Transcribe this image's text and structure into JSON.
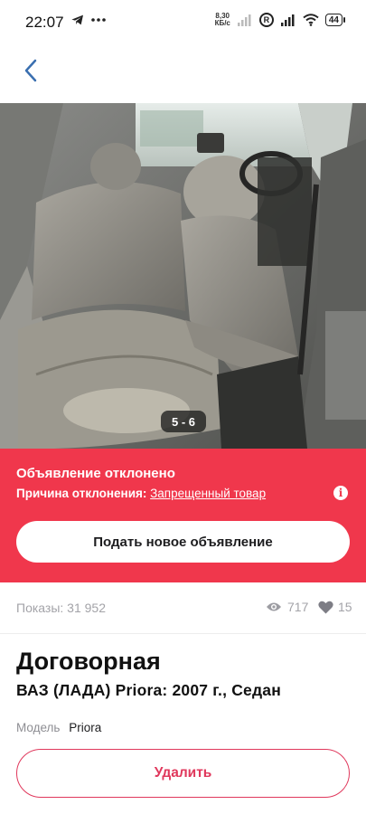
{
  "status_bar": {
    "time": "22:07",
    "net_speed_value": "8,30",
    "net_speed_unit": "КБ/с",
    "roaming": "R",
    "battery": "44"
  },
  "photo": {
    "counter": "5 - 6"
  },
  "rejection": {
    "title": "Объявление отклонено",
    "reason_label": "Причина отклонения:",
    "reason_value": "Запрещенный товар",
    "new_ad_button": "Подать новое объявление"
  },
  "stats": {
    "views_label": "Показы: 31 952",
    "eye_count": "717",
    "favorites_count": "15"
  },
  "listing": {
    "price": "Договорная",
    "title": "ВАЗ (ЛАДА) Priora: 2007 г., Седан",
    "model_label": "Модель",
    "model_value": "Priora",
    "delete_button": "Удалить"
  },
  "colors": {
    "accent_red": "#f0374c",
    "delete_pink": "#e0385c",
    "muted_gray": "#a3a3a8"
  },
  "icons": {
    "back": "chevron-left-icon",
    "telegram": "telegram-icon",
    "more": "more-dots-icon",
    "signal": "signal-icon",
    "wifi": "wifi-icon",
    "info": "info-icon",
    "eye": "eye-icon",
    "heart": "heart-icon"
  }
}
